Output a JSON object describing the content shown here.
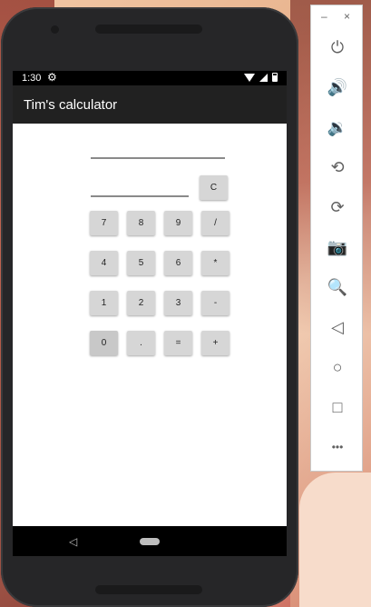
{
  "statusbar": {
    "time": "1:30"
  },
  "appbar": {
    "title": "Tim's calculator"
  },
  "calculator": {
    "clear_label": "C",
    "rows": [
      [
        "7",
        "8",
        "9",
        "/"
      ],
      [
        "4",
        "5",
        "6",
        "*"
      ],
      [
        "1",
        "2",
        "3",
        "-"
      ],
      [
        "0",
        ".",
        "=",
        "+"
      ]
    ]
  },
  "emulator_panel": {
    "minimize_label": "–",
    "close_label": "×",
    "tools": [
      {
        "name": "power-icon",
        "glyph": "⏻"
      },
      {
        "name": "volume-up-icon",
        "glyph": "🔊"
      },
      {
        "name": "volume-down-icon",
        "glyph": "🔉"
      },
      {
        "name": "rotate-left-icon",
        "glyph": "⟲"
      },
      {
        "name": "rotate-right-icon",
        "glyph": "⟳"
      },
      {
        "name": "camera-icon",
        "glyph": "📷"
      },
      {
        "name": "zoom-icon",
        "glyph": "🔍"
      },
      {
        "name": "back-icon",
        "glyph": "◁"
      },
      {
        "name": "home-icon",
        "glyph": "○"
      },
      {
        "name": "overview-icon",
        "glyph": "□"
      },
      {
        "name": "more-icon",
        "glyph": "•••"
      }
    ]
  },
  "colors": {
    "app_bar": "#212121",
    "button_bg": "#d6d6d6",
    "screen_bg": "#ffffff"
  }
}
